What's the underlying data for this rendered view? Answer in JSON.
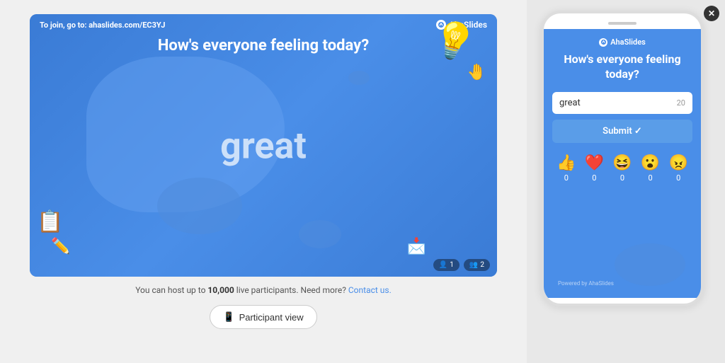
{
  "slide": {
    "join_prefix": "To join, go to: ",
    "join_url": "ahaslides.com/EC3YJ",
    "logo": "AhaSlides",
    "question": "How's everyone feeling today?",
    "word": "great",
    "badge_participants": "1",
    "badge_users": "2"
  },
  "info": {
    "text_prefix": "You can host up to ",
    "limit": "10,000",
    "text_suffix": " live participants. Need more? ",
    "contact_link": "Contact us."
  },
  "participant_btn": {
    "label": "Participant view"
  },
  "phone": {
    "logo": "AhaSlides",
    "question": "How's everyone feeling today?",
    "input_value": "great",
    "input_count": "20",
    "submit_label": "Submit ✓",
    "reactions": [
      {
        "emoji": "👍",
        "count": "0"
      },
      {
        "emoji": "❤️",
        "count": "0"
      },
      {
        "emoji": "😆",
        "count": "0"
      },
      {
        "emoji": "😮",
        "count": "0"
      },
      {
        "emoji": "😠",
        "count": "0"
      }
    ],
    "powered": "Powered by AhaSlides"
  },
  "close_label": "✕"
}
